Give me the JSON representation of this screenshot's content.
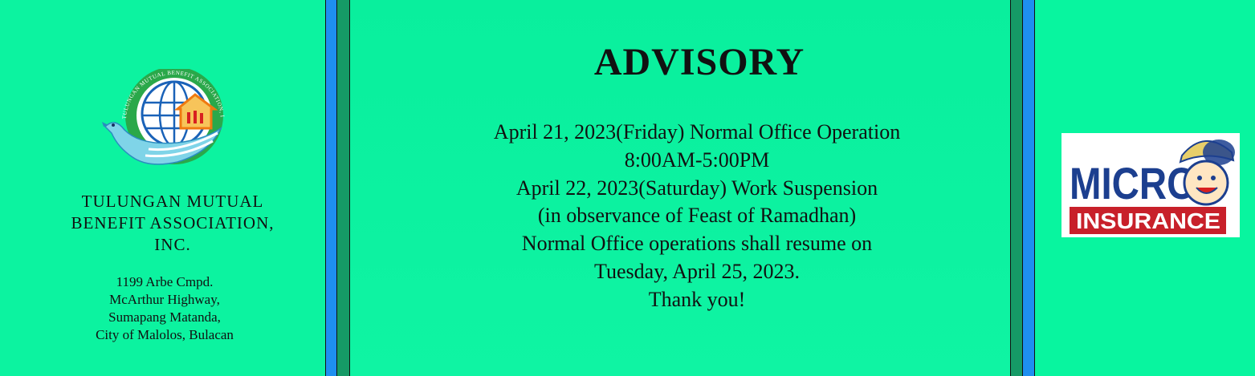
{
  "organization": {
    "name_lines": [
      "TULUNGAN MUTUAL",
      "BENEFIT ASSOCIATION,",
      "INC."
    ],
    "address_lines": [
      "1199 Arbe Cmpd.",
      "McArthur Highway,",
      "Sumapang Matanda,",
      "City of Malolos, Bulacan"
    ],
    "logo": {
      "icon": "globe-dove-house-logo",
      "ring_text": "TULUNGAN MUTUAL BENEFIT ASSOCIATION, INC.",
      "colors": {
        "ring": "#2aa84a",
        "globe": "#1a62b8",
        "house": "#f07a10",
        "dove": "#7fd4e8"
      }
    }
  },
  "advisory": {
    "title": "ADVISORY",
    "lines": [
      "April 21, 2023(Friday) Normal Office Operation",
      "8:00AM-5:00PM",
      "April 22, 2023(Saturday) Work Suspension",
      "(in observance of Feast of Ramadhan)",
      "Normal Office operations shall resume on",
      "Tuesday, April 25, 2023.",
      "Thank you!"
    ]
  },
  "micro_insurance_logo": {
    "word_top": "MICRO",
    "word_bottom": "INSURANCE",
    "icon": "smiling-boy-face-icon",
    "colors": {
      "text_top": "#1c3f8f",
      "band": "#c8202a",
      "hat": "#e8cf6a"
    }
  },
  "colors": {
    "background": "#08f49f",
    "stripe_blue": "#1e8ff0",
    "stripe_green": "#159a66"
  }
}
